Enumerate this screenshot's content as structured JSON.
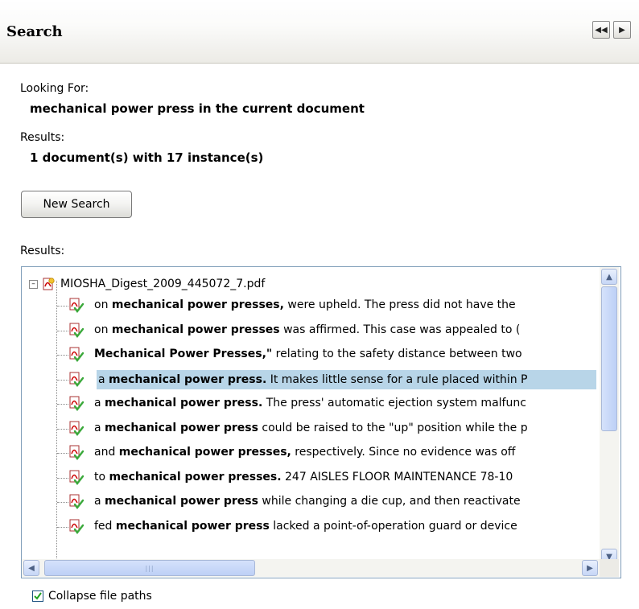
{
  "header": {
    "title": "Search"
  },
  "info": {
    "looking_for_label": "Looking For:",
    "looking_for_value": "mechanical power press in the current document",
    "results_label": "Results:",
    "results_value": "1 document(s) with 17 instance(s)",
    "new_search_label": "New Search",
    "results_list_label": "Results:"
  },
  "tree": {
    "root_file": "MIOSHA_Digest_2009_445072_7.pdf",
    "results": [
      {
        "pre": "on ",
        "bold": "mechanical power presses,",
        "post": " were upheld. The press did not have the"
      },
      {
        "pre": "on ",
        "bold": "mechanical power presses",
        "post": " was affirmed. This case was appealed to ("
      },
      {
        "pre": "",
        "bold": "Mechanical Power Presses,\"",
        "post": " relating to the safety distance between two"
      },
      {
        "pre": "a ",
        "bold": "mechanical power press.",
        "post": " It makes little sense for a rule placed within P",
        "selected": true
      },
      {
        "pre": "a ",
        "bold": "mechanical power press.",
        "post": " The press' automatic ejection system malfunc"
      },
      {
        "pre": "a ",
        "bold": "mechanical power press",
        "post": " could be raised to the \"up\" position while the p"
      },
      {
        "pre": "and ",
        "bold": "mechanical power presses,",
        "post": " respectively. Since no evidence was off"
      },
      {
        "pre": "to ",
        "bold": "mechanical power presses.",
        "post": " 247 AISLES FLOOR MAINTENANCE 78-10"
      },
      {
        "pre": "a ",
        "bold": "mechanical power press",
        "post": " while changing a die cup, and then reactivate"
      },
      {
        "pre": "fed ",
        "bold": "mechanical power press",
        "post": " lacked a point-of-operation guard or device"
      }
    ]
  },
  "options": {
    "collapse_paths_label": "Collapse file paths",
    "collapse_paths_checked": true
  },
  "icons": {
    "result_icon": "pdf-check-icon",
    "file_icon": "pdf-file-icon"
  },
  "colors": {
    "selection": "#b8d5e8",
    "scroll_accent": "#c6d6f6"
  }
}
